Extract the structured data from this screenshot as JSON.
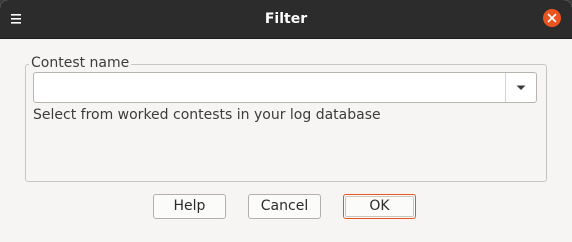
{
  "window": {
    "title": "Filter",
    "menu_icon": "hamburger-menu-icon",
    "close_icon": "close-icon",
    "close_color": "#e95420"
  },
  "group": {
    "legend": "Contest name",
    "combo_value": "",
    "combo_arrow_icon": "chevron-down-icon",
    "hint": "Select from worked contests in your log database"
  },
  "buttons": {
    "help": "Help",
    "cancel": "Cancel",
    "ok": "OK"
  },
  "colors": {
    "titlebar": "#2c2c2c",
    "accent": "#e95420",
    "background": "#f6f5f4"
  }
}
